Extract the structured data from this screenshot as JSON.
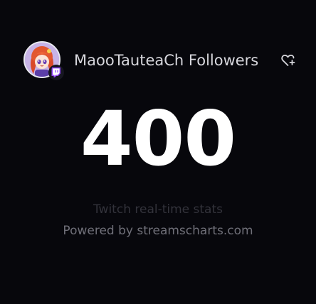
{
  "header": {
    "channel_title": "MaooTauteaCh Followers",
    "avatar_icon": "streamer-avatar",
    "platform_icon": "twitch-icon",
    "action_icon": "heart-plus-icon"
  },
  "stats": {
    "follower_count": "400"
  },
  "footer": {
    "subtitle": "Twitch real-time stats",
    "powered_by": "Powered by streamscharts.com"
  },
  "colors": {
    "background": "#07070c",
    "twitch_purple": "#9146ff",
    "count_text": "#ffffff"
  }
}
